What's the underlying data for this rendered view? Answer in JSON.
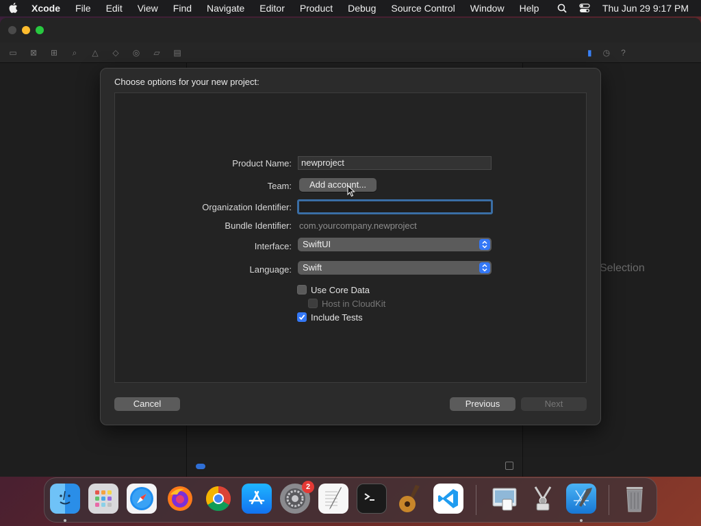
{
  "menubar": {
    "items": [
      "Xcode",
      "File",
      "Edit",
      "View",
      "Find",
      "Navigate",
      "Editor",
      "Product",
      "Debug",
      "Source Control",
      "Window",
      "Help"
    ],
    "datetime": "Thu Jun 29  9:17 PM"
  },
  "background_panel": {
    "no_selection_text": "Selection"
  },
  "sheet": {
    "title": "Choose options for your new project:",
    "product_name_label": "Product Name:",
    "product_name_value": "newproject",
    "team_label": "Team:",
    "team_button": "Add account...",
    "org_id_label": "Organization Identifier:",
    "org_id_value": "",
    "bundle_id_label": "Bundle Identifier:",
    "bundle_id_value": "com.yourcompany.newproject",
    "interface_label": "Interface:",
    "interface_value": "SwiftUI",
    "language_label": "Language:",
    "language_value": "Swift",
    "use_core_data": "Use Core Data",
    "use_core_data_checked": false,
    "host_in_cloudkit": "Host in CloudKit",
    "host_in_cloudkit_checked": false,
    "include_tests": "Include Tests",
    "include_tests_checked": true,
    "cancel_button": "Cancel",
    "previous_button": "Previous",
    "next_button": "Next"
  },
  "dock": {
    "apps": [
      "finder-icon",
      "launchpad-icon",
      "safari-icon",
      "firefox-icon",
      "chrome-icon",
      "app-store-icon",
      "system-settings-icon",
      "textedit-icon",
      "terminal-icon",
      "garageband-icon",
      "vscode-icon",
      "preview-icon",
      "instruments-icon",
      "xcode-icon",
      "trash-icon"
    ],
    "settings_badge": "2"
  },
  "colors": {
    "accent": "#3478f6",
    "focus_ring": "#3a6ea5"
  }
}
